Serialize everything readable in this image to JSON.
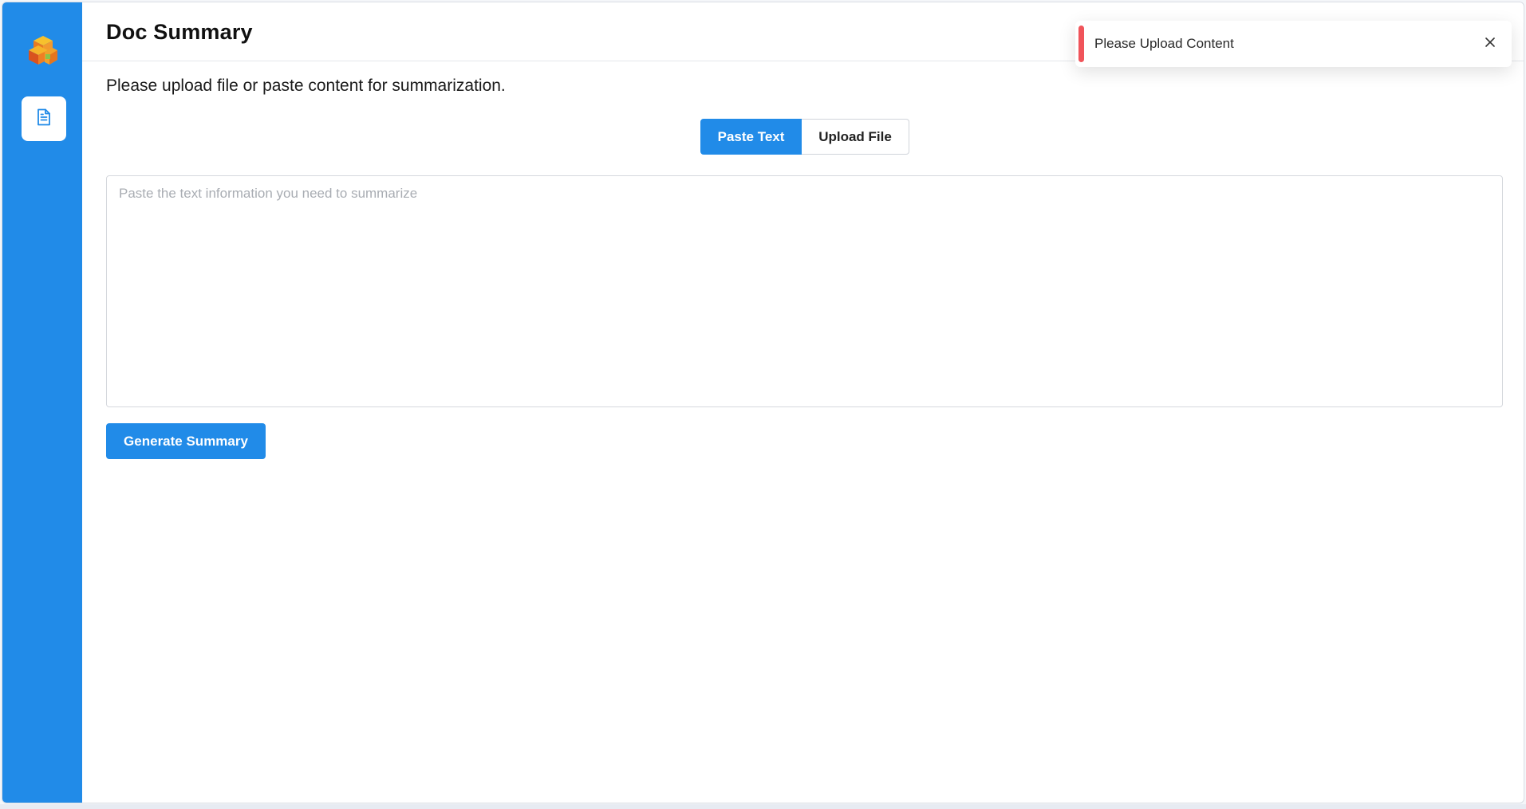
{
  "app": {
    "logo_icon": "stacked-boxes-logo",
    "brand_color": "#218be8"
  },
  "sidebar": {
    "items": [
      {
        "icon": "document-icon",
        "active": true
      }
    ]
  },
  "header": {
    "title": "Doc Summary"
  },
  "main": {
    "description": "Please upload file or paste content for summarization.",
    "tabs": [
      {
        "label": "Paste Text",
        "selected": true
      },
      {
        "label": "Upload File",
        "selected": false
      }
    ],
    "textarea": {
      "value": "",
      "placeholder": "Paste the text information you need to summarize"
    },
    "generate_label": "Generate Summary"
  },
  "toast": {
    "message": "Please Upload Content",
    "status_color": "#f0545a",
    "close_icon": "close-icon"
  }
}
